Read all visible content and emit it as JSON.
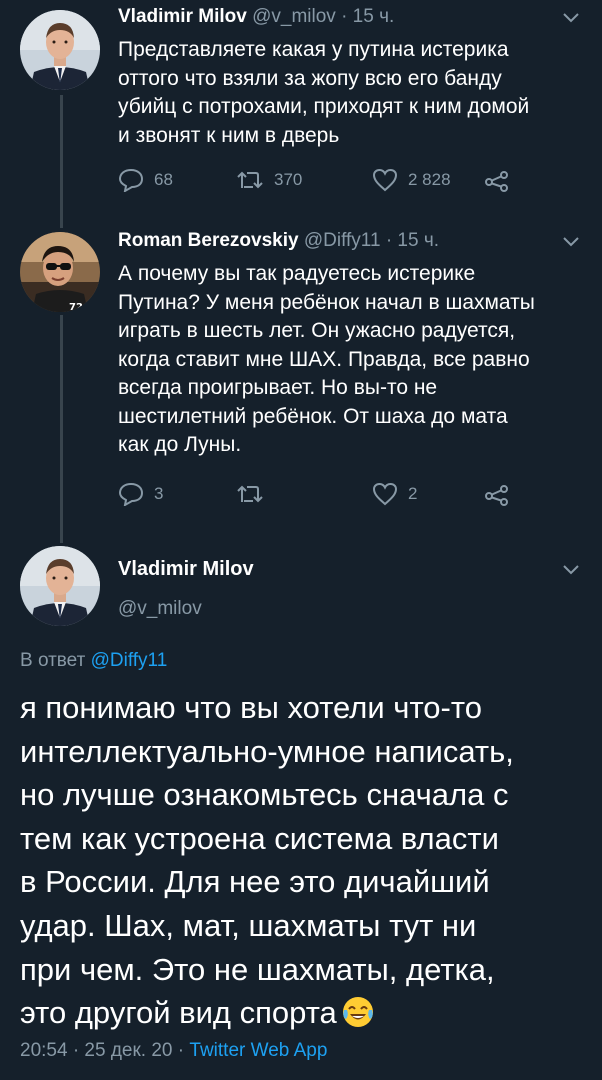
{
  "tweet1": {
    "name": "Vladimir Milov",
    "handle": "@v_milov",
    "time": "· 15 ч.",
    "lines": [
      "Представляете какая у путина истерика",
      "оттого что взяли за жопу всю его банду",
      "убийц с потрохами, приходят к ним домой",
      "и звонят к ним в дверь"
    ],
    "replies": "68",
    "retweets": "370",
    "likes": "2 828"
  },
  "tweet2": {
    "name": "Roman Berezovskiy",
    "handle": "@Diffy11",
    "time": "· 15 ч.",
    "lines": [
      "А почему вы так радуетесь истерике",
      "Путина? У меня ребёнок начал в шахматы",
      "играть в шесть лет. Он ужасно радуется,",
      "когда ставит мне ШАХ. Правда, все равно",
      "всегда проигрывает. Но вы-то не",
      "шестилетний ребёнок. От шаха до мата",
      "как до Луны."
    ],
    "replies": "3",
    "retweets": "",
    "likes": "2"
  },
  "main": {
    "name": "Vladimir Milov",
    "handle": "@v_milov",
    "reply_prefix": "В ответ",
    "reply_handle": "@Diffy11",
    "lines": [
      "я понимаю что вы хотели что-то",
      "интеллектуально-умное написать,",
      "но лучше ознакомьтесь сначала с",
      "тем как устроена система власти",
      "в России. Для нее это дичайший",
      "удар. Шах, мат, шахматы тут ни",
      "при чем. Это не шахматы, детка,",
      "это другой вид спорта"
    ],
    "emoji_name": "face-with-tears-of-joy-icon",
    "timestamp": "20:54 · 25 дек. 20 ·",
    "source": "Twitter Web App"
  },
  "colors": {
    "background": "#15202b",
    "secondary_text": "#8899a6",
    "link": "#1da1f2",
    "thread_line": "#38444d"
  }
}
